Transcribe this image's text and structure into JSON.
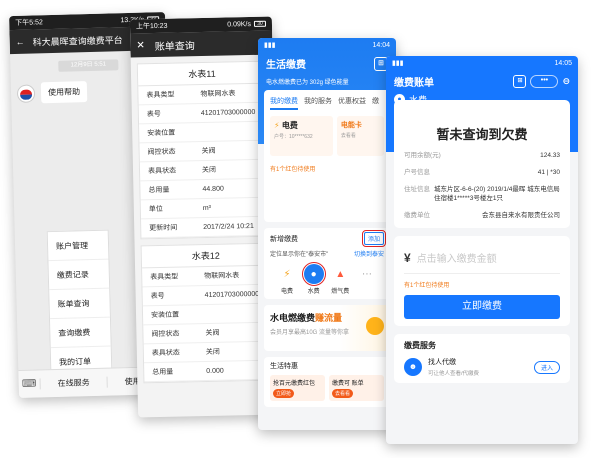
{
  "phone1": {
    "status_left": "下午5:52",
    "status_right": "13.2K/s",
    "status_battery": "32",
    "nav_title": "科大晨晖查询缴费平台",
    "timestamp": "12月9日 5:51",
    "message": "使用帮助",
    "menu": [
      "账户管理",
      "缴费记录",
      "账单查询",
      "查询缴费",
      "我的订单"
    ],
    "bottom": [
      "在线服务",
      "使用帮助"
    ]
  },
  "phone2": {
    "status_left": "上午10:23",
    "status_right": "0.09K/s",
    "status_battery": "30",
    "nav_title": "账单查询",
    "cards": [
      {
        "title": "水表11",
        "rows": [
          {
            "k": "表具类型",
            "v": "物联网水表"
          },
          {
            "k": "表号",
            "v": "41201703000000"
          },
          {
            "k": "安装位置",
            "v": ""
          },
          {
            "k": "阀控状态",
            "v": "关阀"
          },
          {
            "k": "表具状态",
            "v": "关闭"
          },
          {
            "k": "总用量",
            "v": "44.800"
          },
          {
            "k": "单位",
            "v": "m³"
          },
          {
            "k": "更新时间",
            "v": "2017/2/24 10:21"
          }
        ]
      },
      {
        "title": "水表12",
        "rows": [
          {
            "k": "表具类型",
            "v": "物联网水表"
          },
          {
            "k": "表号",
            "v": "41201703000000"
          },
          {
            "k": "安装位置",
            "v": ""
          },
          {
            "k": "阀控状态",
            "v": "关阀"
          },
          {
            "k": "表具状态",
            "v": "关闭"
          },
          {
            "k": "总用量",
            "v": "0.000"
          }
        ]
      }
    ]
  },
  "phone3": {
    "status_time": "14:04",
    "title": "生活缴费",
    "notice": "电水燃缴费已为 302g 绿色能量",
    "tabs": [
      "我的缴费",
      "我的服务",
      "优惠权益",
      "缴"
    ],
    "bill_name": "电费",
    "bill_sub": "户号：10*****632",
    "bill2_name": "电能卡",
    "bill2_sub": "去看看",
    "coupon": "有1个红包待使用",
    "section_title": "新增缴费",
    "add_button": "添加",
    "location": "定位显示你在\"泰安市\"",
    "switch": "切换到泰安",
    "services": [
      "电费",
      "水费",
      "燃气费",
      ""
    ],
    "service_colors": [
      "#f5a623",
      "#1d7cf2",
      "#ff5a3c",
      "#aaaaaa"
    ],
    "banner_title_a": "水电燃缴费",
    "banner_title_b": "赚流量",
    "banner_sub": "会员月享最高10G 流量等你拿",
    "special_title": "生活特惠",
    "special_cards": [
      {
        "t": "抢百元缴费红包",
        "go": "立即抢"
      },
      {
        "t": "缴费可 账单",
        "go": "去看看"
      }
    ]
  },
  "phone4": {
    "status_time": "14:05",
    "title": "缴费账单",
    "sub_title": "水费",
    "result": "暂未查询到欠费",
    "rows": [
      {
        "k": "可用余额(元)",
        "v": "124.33",
        "align": "right"
      },
      {
        "k": "户号信息",
        "v": "41 | *30",
        "align": "right"
      },
      {
        "k": "住址信息",
        "v": "城东片区-6-6-(20) 2019/1/4最晖 城东电信局住宿楼1*****3号楼左1只",
        "align": "left"
      },
      {
        "k": "缴费单位",
        "v": "会东县自来水有限责任公司",
        "align": "right"
      }
    ],
    "currency": "¥",
    "amount_placeholder": "点击输入缴费金额",
    "coupon": "有1个红包待使用",
    "pay_button": "立即缴费",
    "services_title": "缴费服务",
    "service_name": "找人代缴",
    "service_sub": "可让他人查看/代缴费",
    "service_go": "进入"
  }
}
